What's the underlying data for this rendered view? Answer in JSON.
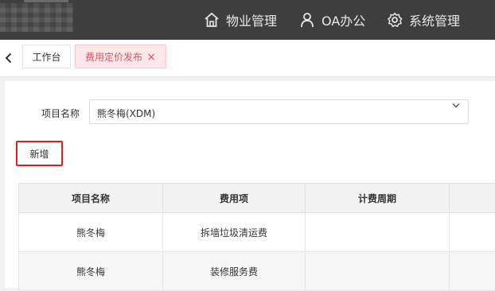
{
  "topbar": {
    "nav": [
      {
        "label": "物业管理",
        "icon": "home-icon"
      },
      {
        "label": "OA办公",
        "icon": "user-icon"
      },
      {
        "label": "系统管理",
        "icon": "gear-icon"
      }
    ]
  },
  "tabs": [
    {
      "label": "工作台"
    },
    {
      "label": "费用定价发布",
      "active": true,
      "close": "×"
    }
  ],
  "form": {
    "project_label": "项目名称",
    "project_value": "熊冬梅(XDM)"
  },
  "toolbar": {
    "add_label": "新增"
  },
  "table": {
    "headers": [
      "项目名称",
      "费用项",
      "计费周期",
      ""
    ],
    "rows": [
      [
        "熊冬梅",
        "拆墙垃圾清运费",
        "",
        ""
      ],
      [
        "熊冬梅",
        "装修服务费",
        "",
        ""
      ]
    ]
  },
  "colors": {
    "topbar": "#3e3e3e",
    "active_tab": "#e0525f",
    "highlight_border": "#e02020"
  }
}
